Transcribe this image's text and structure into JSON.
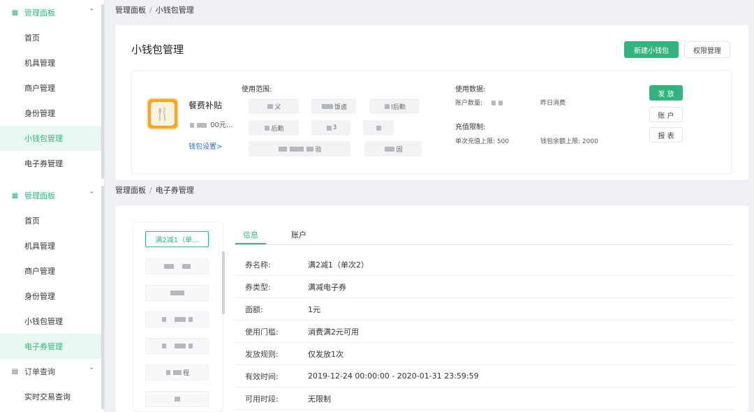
{
  "top": {
    "sidebar": {
      "header": "管理面板",
      "items": [
        "首页",
        "机具管理",
        "商户管理",
        "身份管理",
        "小钱包管理",
        "电子券管理"
      ]
    },
    "breadcrumb": [
      "管理面板",
      "小钱包管理"
    ],
    "title": "小钱包管理",
    "buttons": {
      "new": "新建小钱包",
      "perm": "权限管理"
    },
    "wallet": {
      "name": "餐费补贴",
      "amount_suffix": "00元...",
      "settings_link": "钱包设置>",
      "scope_label": "使用范围:",
      "scope_chips": [
        "义",
        "饭卤",
        "I后勤",
        "后勤",
        "3",
        "",
        "验",
        "固"
      ],
      "usage_label": "使用数据:",
      "account_count_label": "账户数量:",
      "yesterday_label": "昨日消费",
      "limit_label": "充值限制:",
      "single_limit": "单次充值上限: 500",
      "balance_limit": "钱包余额上限: 2000",
      "actions": [
        "发 放",
        "账 户",
        "报 表"
      ]
    }
  },
  "bottom": {
    "sidebar": {
      "header": "管理面板",
      "items": [
        "首页",
        "机具管理",
        "商户管理",
        "身份管理",
        "小钱包管理",
        "电子券管理"
      ],
      "header2": "订单查询",
      "items2": [
        "实时交易查询"
      ]
    },
    "breadcrumb": [
      "管理面板",
      "电子券管理"
    ],
    "coupons": [
      "满2减1（单...",
      "",
      "",
      "",
      "",
      "程",
      ""
    ],
    "tabs": [
      "信息",
      "账户"
    ],
    "details": [
      {
        "label": "券名称:",
        "value": "满2减1（单次2）"
      },
      {
        "label": "券类型:",
        "value": "满减电子券"
      },
      {
        "label": "面额:",
        "value": "1元"
      },
      {
        "label": "使用门槛:",
        "value": "消费满2元可用"
      },
      {
        "label": "发放规则:",
        "value": "仅发放1次"
      },
      {
        "label": "有效时间:",
        "value": "2019-12-24 00:00:00 - 2020-01-31 23:59:59"
      },
      {
        "label": "可用时段:",
        "value": "无限制"
      }
    ]
  },
  "colors": {
    "accent": "#35b37e",
    "link": "#2f6fbd",
    "icon_bg": "#f5a623"
  }
}
